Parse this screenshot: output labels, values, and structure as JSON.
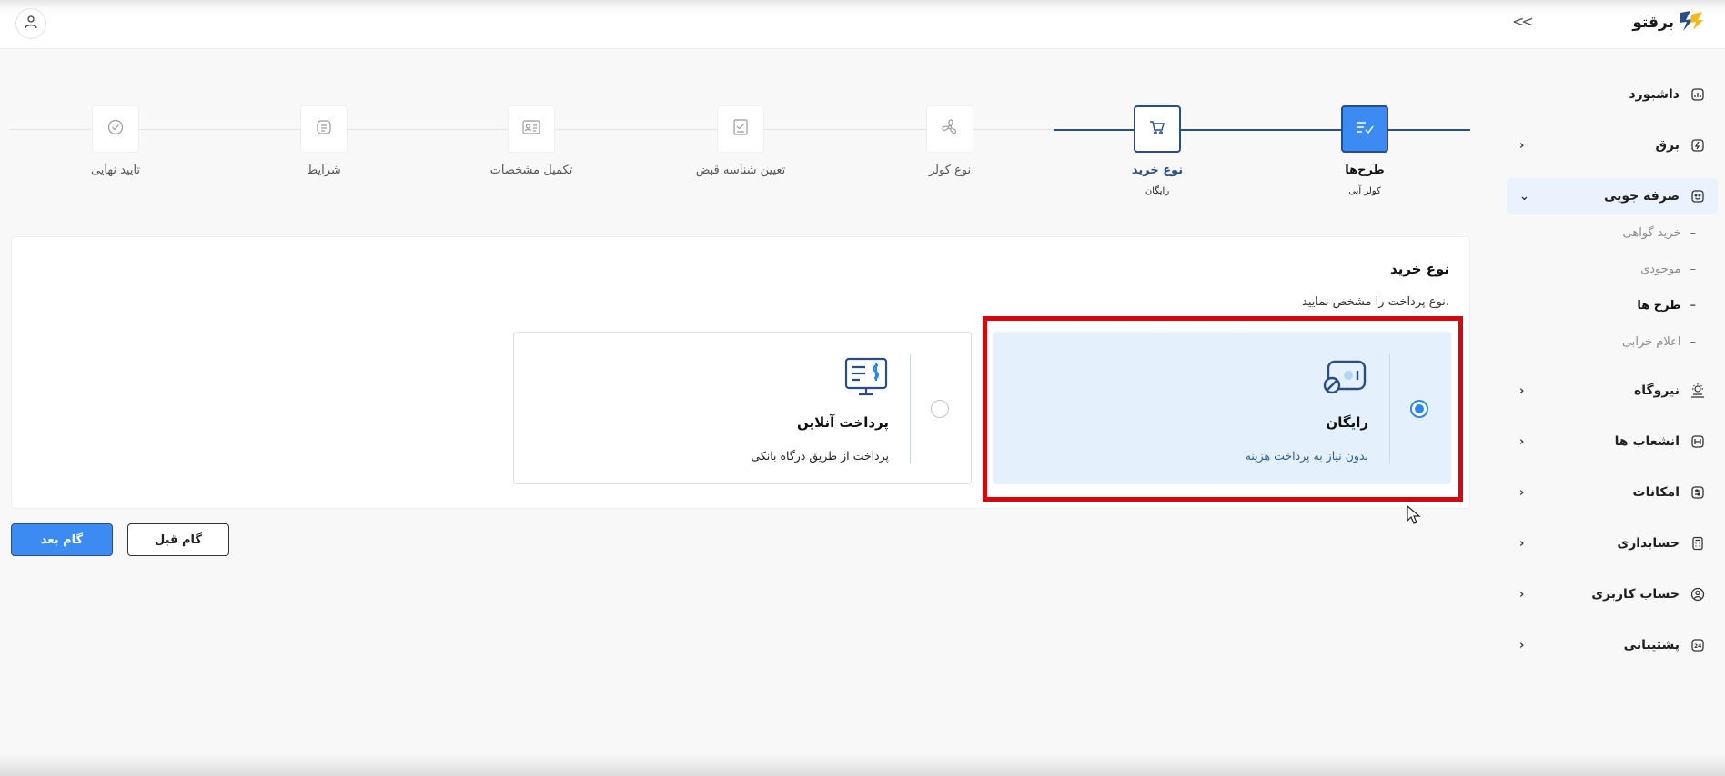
{
  "app": {
    "logo_text": "برقتو"
  },
  "topbar": {
    "collapse_glyph": "<<"
  },
  "sidebar": {
    "items": [
      {
        "label": "داشبورد",
        "icon": "dashboard-icon",
        "has_chevron": false
      },
      {
        "label": "برق",
        "icon": "electricity-icon",
        "has_chevron": true
      },
      {
        "label": "صرفه جویی",
        "icon": "saving-icon",
        "has_chevron": true,
        "expanded": true
      },
      {
        "label": "نیروگاه",
        "icon": "power-plant-icon",
        "has_chevron": true
      },
      {
        "label": "انشعاب ها",
        "icon": "branch-icon",
        "has_chevron": true
      },
      {
        "label": "امکانات",
        "icon": "features-icon",
        "has_chevron": true
      },
      {
        "label": "حسابداری",
        "icon": "accounting-icon",
        "has_chevron": true
      },
      {
        "label": "حساب کاربری",
        "icon": "user-account-icon",
        "has_chevron": true
      },
      {
        "label": "پشتیبانی",
        "icon": "support-icon",
        "has_chevron": true
      }
    ],
    "saving_subitems": [
      {
        "label": "خرید گواهی",
        "active": false
      },
      {
        "label": "موجودی",
        "active": false
      },
      {
        "label": "طرح ها",
        "active": true
      },
      {
        "label": "اعلام خرابی",
        "active": false
      }
    ],
    "chevron_left": "›",
    "chevron_down": "⌄",
    "dash": "–"
  },
  "stepper": {
    "steps": [
      {
        "title": "طرح‌ها",
        "sub": "کولر آبی",
        "state": "done",
        "icon": "plan-list-icon"
      },
      {
        "title": "نوع خرید",
        "sub": "رایگان",
        "state": "current",
        "icon": "cart-icon"
      },
      {
        "title": "نوع کولر",
        "sub": "",
        "state": "pending",
        "icon": "fan-icon"
      },
      {
        "title": "تعیین شناسه قبض",
        "sub": "",
        "state": "pending",
        "icon": "bill-check-icon"
      },
      {
        "title": "تکمیل مشخصات",
        "sub": "",
        "state": "pending",
        "icon": "id-card-icon"
      },
      {
        "title": "شرایط",
        "sub": "",
        "state": "pending",
        "icon": "terms-icon"
      },
      {
        "title": "تایید نهایی",
        "sub": "",
        "state": "pending",
        "icon": "check-circle-icon"
      }
    ]
  },
  "main": {
    "title": "نوع خرید",
    "description": "نوع پرداخت را مشخص نمایید.",
    "options": [
      {
        "title": "رایگان",
        "subtitle": "بدون نیاز به پرداخت هزینه",
        "selected": true,
        "icon": "free-ticket-icon"
      },
      {
        "title": "پرداخت آنلاین",
        "subtitle": "پرداخت از طریق درگاه بانکی",
        "selected": false,
        "icon": "online-payment-icon"
      }
    ]
  },
  "buttons": {
    "next_label": "گام بعد",
    "prev_label": "گام قبل"
  },
  "colors": {
    "accent": "#3b8bf2",
    "dark_blue": "#2a4d86",
    "selected_bg": "#e4f0fc",
    "highlight": "#d6070f"
  }
}
